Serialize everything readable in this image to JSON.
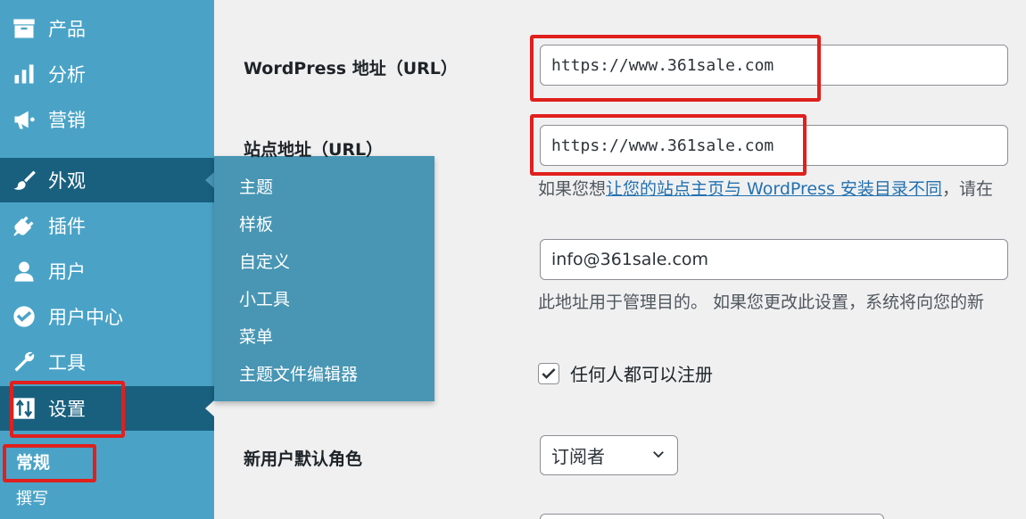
{
  "sidebar": {
    "items": [
      {
        "label": "产品",
        "icon": "archive-icon"
      },
      {
        "label": "分析",
        "icon": "bar-chart-icon"
      },
      {
        "label": "营销",
        "icon": "megaphone-icon"
      },
      {
        "label": "外观",
        "icon": "paintbrush-icon"
      },
      {
        "label": "插件",
        "icon": "plugin-icon"
      },
      {
        "label": "用户",
        "icon": "user-icon"
      },
      {
        "label": "用户中心",
        "icon": "heart-badge-icon"
      },
      {
        "label": "工具",
        "icon": "wrench-icon"
      },
      {
        "label": "设置",
        "icon": "settings-sliders-icon"
      }
    ],
    "submenu": [
      {
        "label": "常规"
      },
      {
        "label": "撰写"
      }
    ]
  },
  "flyout": {
    "items": [
      "主题",
      "样板",
      "自定义",
      "小工具",
      "菜单",
      "主题文件编辑器"
    ]
  },
  "form": {
    "wp_url_label": "WordPress 地址（URL）",
    "wp_url_value": "https://www.361sale.com",
    "site_url_label": "站点地址（URL）",
    "site_url_value": "https://www.361sale.com",
    "site_url_desc_prefix": "如果您想",
    "site_url_desc_link": "让您的站点主页与 WordPress 安装目录不同",
    "site_url_desc_suffix": "，请在",
    "email_value": "info@361sale.com",
    "email_desc": "此地址用于管理目的。 如果您更改此设置，系统将向您的新",
    "membership_label": "任何人都可以注册",
    "membership_checked": true,
    "default_role_label": "新用户默认角色",
    "default_role_value": "订阅者"
  },
  "colors": {
    "sidebar_bg": "#4aa3c7",
    "sidebar_active_bg": "#19607f",
    "flyout_bg": "#4896b4",
    "link": "#2271b1",
    "highlight": "#e0201d"
  }
}
